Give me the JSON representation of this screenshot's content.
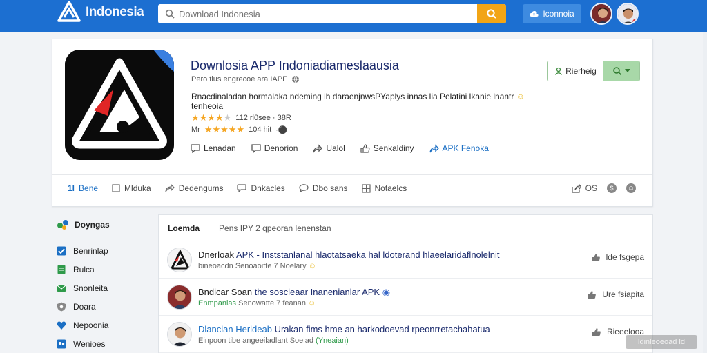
{
  "header": {
    "brand": "Indonesia",
    "search_placeholder": "Download Indonesia",
    "login_label": "Iconnoia",
    "accent": "#1c6fd1",
    "search_button_color": "#f2a516"
  },
  "app": {
    "title": "Downlosia APP Indoniadiameslaausia",
    "subtitle": "Pero tius engrecoe ara IAPF",
    "description": "Rnacdinaladan hormalaka ndeming lh daraenjnwsPYaplys innas lia Pelatini lkanie lnantr",
    "description_tail": "tenheoia",
    "rating_1": {
      "stars": 4,
      "max": 5,
      "text": "112 rl0see · 38R"
    },
    "rating_2": {
      "prefix": "Mr",
      "stars": 5,
      "max": 5,
      "text": "104 hit"
    },
    "actions": [
      "Lenadan",
      "Denorion",
      "Ualol",
      "Senkaldiny",
      "APK Fenoka"
    ],
    "install_label": "Rierheig"
  },
  "tabs": {
    "items": [
      "Bene",
      "Mlduka",
      "Dedengums",
      "Dnkacles",
      "Dbo sans",
      "Notaelcs"
    ],
    "share_count": "OS"
  },
  "sidebar": {
    "title": "Doyngas",
    "items": [
      {
        "label": "Benrinlap",
        "color": "#1b6fc4"
      },
      {
        "label": "Rulca",
        "color": "#2f9a4a"
      },
      {
        "label": "Snonleita",
        "color": "#2f9a4a"
      },
      {
        "label": "Doara",
        "color": "#888888"
      },
      {
        "label": "Nepoonia",
        "color": "#1b6fc4"
      },
      {
        "label": "Wenioes",
        "color": "#1b6fc4"
      }
    ]
  },
  "feed": {
    "tab_active": "Loemda",
    "tab_other": "Pens IPY 2 qpeoran lenenstan",
    "posts": [
      {
        "name": "Dnerloak",
        "title": "APK - Inststanlanal hlaotatsaeka hal ldoterand hlaeelaridaflnolelnit",
        "meta": "bineoacdn",
        "meta_hl": "Senoaoitte 7 Noelary",
        "like": "lde fsgepa"
      },
      {
        "name": "Bndicar Soan",
        "title": "the soscleaar Inanenianlar APK",
        "meta": "Enmpanias",
        "meta_hl": "Senowatte 7 feanan",
        "like": "Ure fsiapita"
      },
      {
        "name": "Dlanclan Herldeab",
        "title": "Urakan fims hme an harkodoevad rpeonrretachahatua",
        "meta": "Einpoon tibe angeeiladlant Soeiad",
        "meta_hl": "(Yneaian)",
        "like": "Rieeelooa"
      }
    ]
  },
  "watermark": "ldinleoeoad ld"
}
